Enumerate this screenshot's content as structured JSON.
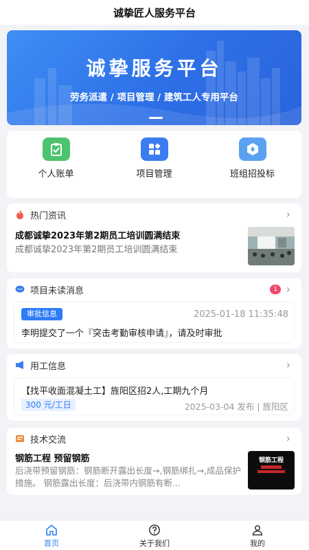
{
  "app": {
    "title": "诚挚匠人服务平台"
  },
  "banner": {
    "title": "诚挚服务平台",
    "subtitle": "劳务派遣 / 项目管理 / 建筑工人专用平台"
  },
  "quick_actions": [
    {
      "label": "个人账单",
      "icon": "clipboard-check-icon",
      "color": "#4cc36e"
    },
    {
      "label": "项目管理",
      "icon": "grid-apps-icon",
      "color": "#3b7cf0"
    },
    {
      "label": "班组招投标",
      "icon": "hexagon-icon",
      "color": "#5aa2f0"
    }
  ],
  "news": {
    "section_title": "热门资讯",
    "headline": "成都诚挚2023年第2期员工培训圆满结束",
    "summary": "成都诚挚2023年第2期员工培训圆满结束"
  },
  "messages": {
    "section_title": "项目未读消息",
    "unread_count": "1",
    "tag": "审批信息",
    "time": "2025-01-18 11:35:48",
    "text": "李明提交了一个『突击考勤审核申请』，请及时审批"
  },
  "jobs": {
    "section_title": "用工信息",
    "title": "【找平收面混凝土工】旌阳区招2人,工期九个月",
    "salary": "300 元/工日",
    "meta": "2025-03-04 发布 | 旌阳区"
  },
  "tech": {
    "section_title": "技术交流",
    "headline": "钢筋工程 预留钢筋",
    "summary": "后浇带预留钢筋：钢筋断开露出长度→,钢筋绑扎→,成品保护措施。 钢筋露出长度：后浇带内钢筋有断...",
    "thumb_text": "钢筋工程"
  },
  "tabbar": [
    {
      "label": "首页",
      "icon": "home-icon",
      "active": true
    },
    {
      "label": "关于我们",
      "icon": "question-circle-icon",
      "active": false
    },
    {
      "label": "我的",
      "icon": "user-icon",
      "active": false
    }
  ],
  "colors": {
    "accent": "#2f7cf6",
    "badge": "#f2476b",
    "background": "#f2f3f7"
  }
}
